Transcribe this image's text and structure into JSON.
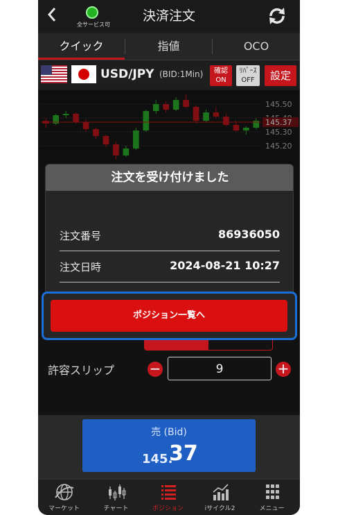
{
  "header": {
    "back_label": "<",
    "status_label": "全サービス可",
    "title": "決済注文"
  },
  "tabs": [
    {
      "label": "クイック",
      "active": true
    },
    {
      "label": "指値",
      "active": false
    },
    {
      "label": "OCO",
      "active": false
    }
  ],
  "pair_row": {
    "pair": "USD/JPY",
    "bid_type": "(BID:1Min)",
    "confirm_label_top": "確認",
    "confirm_label_bottom": "ON",
    "repeat_label_top": "ﾘﾊﾟｰｽ",
    "repeat_label_bottom": "OFF",
    "settings_label": "設定"
  },
  "chart_data": {
    "type": "candlestick",
    "yticks": [
      "145.50",
      "145.40",
      "145.30",
      "145.20"
    ],
    "current_price_label": "145.37",
    "colors": {
      "up": "#2bb22b",
      "down": "#c5161d"
    },
    "candles": [
      {
        "o": 145.38,
        "h": 145.4,
        "l": 145.33,
        "c": 145.36
      },
      {
        "o": 145.36,
        "h": 145.43,
        "l": 145.35,
        "c": 145.42
      },
      {
        "o": 145.42,
        "h": 145.45,
        "l": 145.4,
        "c": 145.43
      },
      {
        "o": 145.43,
        "h": 145.44,
        "l": 145.36,
        "c": 145.37
      },
      {
        "o": 145.37,
        "h": 145.39,
        "l": 145.3,
        "c": 145.32
      },
      {
        "o": 145.32,
        "h": 145.33,
        "l": 145.25,
        "c": 145.27
      },
      {
        "o": 145.27,
        "h": 145.28,
        "l": 145.19,
        "c": 145.21
      },
      {
        "o": 145.21,
        "h": 145.23,
        "l": 145.1,
        "c": 145.13
      },
      {
        "o": 145.13,
        "h": 145.2,
        "l": 145.12,
        "c": 145.18
      },
      {
        "o": 145.18,
        "h": 145.33,
        "l": 145.17,
        "c": 145.31
      },
      {
        "o": 145.31,
        "h": 145.46,
        "l": 145.3,
        "c": 145.45
      },
      {
        "o": 145.45,
        "h": 145.53,
        "l": 145.43,
        "c": 145.5
      },
      {
        "o": 145.5,
        "h": 145.52,
        "l": 145.44,
        "c": 145.46
      },
      {
        "o": 145.46,
        "h": 145.55,
        "l": 145.45,
        "c": 145.53
      },
      {
        "o": 145.53,
        "h": 145.57,
        "l": 145.47,
        "c": 145.48
      },
      {
        "o": 145.48,
        "h": 145.49,
        "l": 145.36,
        "c": 145.38
      },
      {
        "o": 145.38,
        "h": 145.46,
        "l": 145.37,
        "c": 145.44
      },
      {
        "o": 145.44,
        "h": 145.48,
        "l": 145.4,
        "c": 145.41
      },
      {
        "o": 145.41,
        "h": 145.43,
        "l": 145.34,
        "c": 145.35
      },
      {
        "o": 145.35,
        "h": 145.38,
        "l": 145.3,
        "c": 145.31
      },
      {
        "o": 145.31,
        "h": 145.34,
        "l": 145.28,
        "c": 145.33
      },
      {
        "o": 145.33,
        "h": 145.4,
        "l": 145.32,
        "c": 145.38
      }
    ],
    "ylim": [
      145.05,
      145.6
    ]
  },
  "slip": {
    "label": "許容スリップ",
    "value": "9",
    "minus_label": "−",
    "plus_label": "+"
  },
  "order": {
    "sell_label": "売 (Bid)",
    "price_small": "145.",
    "price_big": "37"
  },
  "modal": {
    "title": "注文を受け付けました",
    "rows": [
      {
        "key": "注文番号",
        "value": "86936050"
      },
      {
        "key": "注文日時",
        "value": "2024-08-21 10:27"
      }
    ],
    "cta_label": "ポジション一覧へ"
  },
  "nav": [
    {
      "label": "マーケット",
      "icon": "globe-icon",
      "active": false
    },
    {
      "label": "チャート",
      "icon": "candlestick-icon",
      "active": false
    },
    {
      "label": "ポジション",
      "icon": "list-icon",
      "active": true
    },
    {
      "label": "iサイクル2",
      "icon": "line-chart-icon",
      "active": false
    },
    {
      "label": "メニュー",
      "icon": "grid-icon",
      "active": false
    }
  ]
}
